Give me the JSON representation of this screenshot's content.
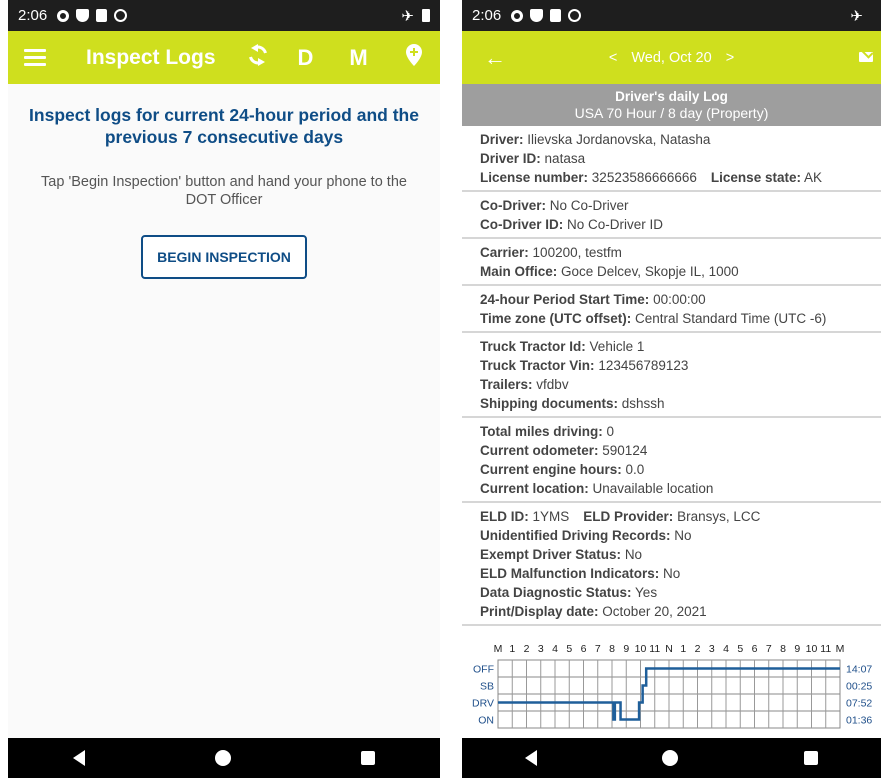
{
  "left": {
    "status": {
      "time": "2:06"
    },
    "appbar": {
      "title": "Inspect Logs",
      "btn_d": "D",
      "btn_m": "M"
    },
    "headline": "Inspect logs for current 24-hour period and the previous 7 consecutive days",
    "instruction": "Tap 'Begin Inspection' button and hand your phone to the DOT Officer",
    "begin_button": "BEGIN INSPECTION"
  },
  "right": {
    "status": {
      "time": "2:06"
    },
    "date_nav": {
      "prev": "<",
      "date": "Wed, Oct 20",
      "next": ">"
    },
    "log_header": {
      "title": "Driver's daily Log",
      "subtitle": "USA 70 Hour / 8 day (Property)"
    },
    "fields": {
      "driver_l": "Driver:",
      "driver_v": "Ilievska Jordanovska, Natasha",
      "driver_id_l": "Driver ID:",
      "driver_id_v": "natasa",
      "license_l": "License number:",
      "license_v": "32523586666666",
      "license_state_l": "License state:",
      "license_state_v": "AK",
      "codriver_l": "Co-Driver:",
      "codriver_v": "No Co-Driver",
      "codriver_id_l": "Co-Driver ID:",
      "codriver_id_v": "No Co-Driver ID",
      "carrier_l": "Carrier:",
      "carrier_v": "100200, testfm",
      "main_office_l": "Main Office:",
      "main_office_v": "Goce Delcev, Skopje IL, 1000",
      "period_start_l": "24-hour Period Start Time:",
      "period_start_v": "00:00:00",
      "timezone_l": "Time zone (UTC offset):",
      "timezone_v": "Central Standard Time (UTC -6)",
      "tractor_id_l": "Truck Tractor Id:",
      "tractor_id_v": "Vehicle 1",
      "tractor_vin_l": "Truck Tractor Vin:",
      "tractor_vin_v": "123456789123",
      "trailers_l": "Trailers:",
      "trailers_v": "vfdbv",
      "shipping_l": "Shipping documents:",
      "shipping_v": "dshssh",
      "miles_l": "Total miles driving:",
      "miles_v": "0",
      "odometer_l": "Current odometer:",
      "odometer_v": "590124",
      "engine_l": "Current engine hours:",
      "engine_v": "0.0",
      "location_l": "Current location:",
      "location_v": "Unavailable location",
      "eld_id_l": "ELD ID:",
      "eld_id_v": "1YMS",
      "eld_provider_l": "ELD Provider:",
      "eld_provider_v": "Bransys, LCC",
      "unidentified_l": "Unidentified Driving Records:",
      "unidentified_v": "No",
      "exempt_l": "Exempt Driver Status:",
      "exempt_v": "No",
      "malfunction_l": "ELD Malfunction Indicators:",
      "malfunction_v": "No",
      "diagnostic_l": "Data Diagnostic Status:",
      "diagnostic_v": "Yes",
      "print_date_l": "Print/Display date:",
      "print_date_v": "October 20, 2021"
    }
  },
  "colors": {
    "accent": "#cfdf1e",
    "heading_blue": "#0f4d86",
    "chart_line": "#1f5f9a"
  },
  "chart_data": {
    "type": "line",
    "hour_labels": [
      "M",
      "1",
      "2",
      "3",
      "4",
      "5",
      "6",
      "7",
      "8",
      "9",
      "10",
      "11",
      "N",
      "1",
      "2",
      "3",
      "4",
      "5",
      "6",
      "7",
      "8",
      "9",
      "10",
      "11",
      "M"
    ],
    "rows": [
      "OFF",
      "SB",
      "DRV",
      "ON"
    ],
    "totals": [
      "14:07",
      "00:25",
      "07:52",
      "01:36"
    ],
    "x_range_hours": [
      0,
      24
    ],
    "segments": [
      {
        "status": "DRV",
        "start": 0,
        "end": 8.1
      },
      {
        "status": "ON",
        "start": 8.1,
        "end": 8.2
      },
      {
        "status": "DRV",
        "start": 8.2,
        "end": 8.6
      },
      {
        "status": "ON",
        "start": 8.6,
        "end": 9.9
      },
      {
        "status": "DRV",
        "start": 9.9,
        "end": 10.15
      },
      {
        "status": "SB",
        "start": 10.15,
        "end": 10.4
      },
      {
        "status": "OFF",
        "start": 10.4,
        "end": 24
      }
    ]
  }
}
